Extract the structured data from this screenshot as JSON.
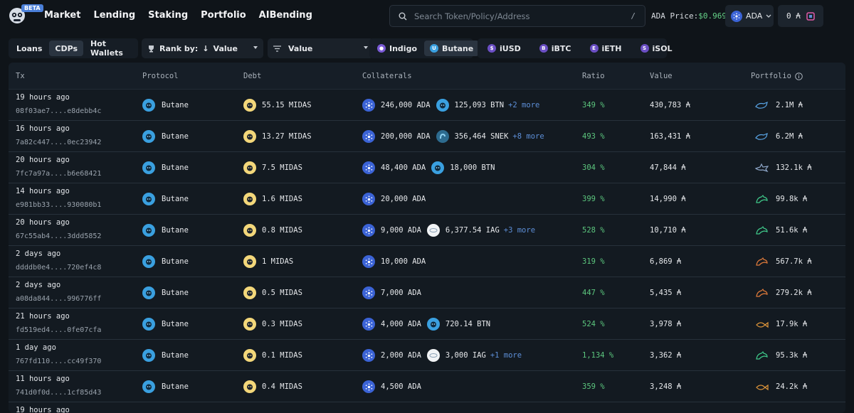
{
  "brand": {
    "beta": "BETA"
  },
  "nav": {
    "items": [
      "Market",
      "Lending",
      "Staking",
      "Portfolio",
      "AIBending"
    ]
  },
  "search": {
    "placeholder": "Search Token/Policy/Address",
    "shortcut": "/"
  },
  "price": {
    "label": "ADA Price:",
    "value": "$0.969"
  },
  "network": {
    "label": "ADA"
  },
  "wallet": {
    "balance": "0 ₳"
  },
  "tabs": {
    "items": [
      "Loans",
      "CDPs",
      "Hot Wallets"
    ],
    "active": "CDPs"
  },
  "rank": {
    "label": "Rank by:",
    "value": "Value"
  },
  "metric": {
    "value": "Value"
  },
  "protocols": {
    "items": [
      "Indigo",
      "Butane"
    ],
    "active": "Butane"
  },
  "assets": {
    "items": [
      "iUSD",
      "iBTC",
      "iETH",
      "iSOL"
    ]
  },
  "columns": {
    "tx": "Tx",
    "protocol": "Protocol",
    "debt": "Debt",
    "collaterals": "Collaterals",
    "ratio": "Ratio",
    "value": "Value",
    "portfolio": "Portfolio"
  },
  "colors": {
    "ratio_green": "#5cc77e",
    "link_blue": "#5d8fd8",
    "price_green": "#67d48a"
  },
  "rows": [
    {
      "time": "19 hours ago",
      "hash": "08f03ae7....e8debb4c",
      "protocol": "Butane",
      "debt": "55.15 MIDAS",
      "col1": "246,000 ADA",
      "col2": "125,093 BTN",
      "col2_token": "btn",
      "more": "+2 more",
      "ratio": "349 %",
      "value": "430,783 ₳",
      "portfolio": "2.1M ₳",
      "icon": "whale-blue"
    },
    {
      "time": "16 hours ago",
      "hash": "7a82c447....0ec23942",
      "protocol": "Butane",
      "debt": "13.27 MIDAS",
      "col1": "200,000 ADA",
      "col2": "356,464 SNEK",
      "col2_token": "snek",
      "more": "+8 more",
      "ratio": "493 %",
      "value": "163,431 ₳",
      "portfolio": "6.2M ₳",
      "icon": "whale-blue"
    },
    {
      "time": "20 hours ago",
      "hash": "7fc7a97a....b6e68421",
      "protocol": "Butane",
      "debt": "7.5 MIDAS",
      "col1": "48,400 ADA",
      "col2": "18,000 BTN",
      "col2_token": "btn",
      "more": "",
      "ratio": "304 %",
      "value": "47,844 ₳",
      "portfolio": "132.1k ₳",
      "icon": "shark-blue"
    },
    {
      "time": "14 hours ago",
      "hash": "e981bb33....930080b1",
      "protocol": "Butane",
      "debt": "1.6 MIDAS",
      "col1": "20,000 ADA",
      "col2": "",
      "col2_token": "",
      "more": "",
      "ratio": "399 %",
      "value": "14,990 ₳",
      "portfolio": "99.8k ₳",
      "icon": "dolphin-green"
    },
    {
      "time": "20 hours ago",
      "hash": "67c55ab4....3ddd5852",
      "protocol": "Butane",
      "debt": "0.8 MIDAS",
      "col1": "9,000 ADA",
      "col2": "6,377.54 IAG",
      "col2_token": "iag",
      "more": "+3 more",
      "ratio": "528 %",
      "value": "10,710 ₳",
      "portfolio": "51.6k ₳",
      "icon": "dolphin-green"
    },
    {
      "time": "2 days ago",
      "hash": "ddddb0e4....720ef4c8",
      "protocol": "Butane",
      "debt": "1 MIDAS",
      "col1": "10,000 ADA",
      "col2": "",
      "col2_token": "",
      "more": "",
      "ratio": "319 %",
      "value": "6,869 ₳",
      "portfolio": "567.7k ₳",
      "icon": "dolphin-orange"
    },
    {
      "time": "2 days ago",
      "hash": "a08da844....996776ff",
      "protocol": "Butane",
      "debt": "0.5 MIDAS",
      "col1": "7,000 ADA",
      "col2": "",
      "col2_token": "",
      "more": "",
      "ratio": "447 %",
      "value": "5,435 ₳",
      "portfolio": "279.2k ₳",
      "icon": "dolphin-orange"
    },
    {
      "time": "21 hours ago",
      "hash": "fd519ed4....0fe07cfa",
      "protocol": "Butane",
      "debt": "0.3 MIDAS",
      "col1": "4,000 ADA",
      "col2": "720.14 BTN",
      "col2_token": "btn",
      "more": "",
      "ratio": "524 %",
      "value": "3,978 ₳",
      "portfolio": "17.9k ₳",
      "icon": "fish-orange"
    },
    {
      "time": "1 day ago",
      "hash": "767fd110....cc49f370",
      "protocol": "Butane",
      "debt": "0.1 MIDAS",
      "col1": "2,000 ADA",
      "col2": "3,000 IAG",
      "col2_token": "iag",
      "more": "+1 more",
      "ratio": "1,134 %",
      "value": "3,362 ₳",
      "portfolio": "95.3k ₳",
      "icon": "dolphin-green"
    },
    {
      "time": "11 hours ago",
      "hash": "741d0f0d....1cf85d43",
      "protocol": "Butane",
      "debt": "0.4 MIDAS",
      "col1": "4,500 ADA",
      "col2": "",
      "col2_token": "",
      "more": "",
      "ratio": "359 %",
      "value": "3,248 ₳",
      "portfolio": "24.2k ₳",
      "icon": "fish-orange"
    },
    {
      "time": "19 hours ago",
      "hash": "",
      "protocol": "",
      "debt": "",
      "col1": "",
      "col2": "",
      "col2_token": "",
      "more": "",
      "ratio": "",
      "value": "",
      "portfolio": "",
      "icon": ""
    }
  ]
}
